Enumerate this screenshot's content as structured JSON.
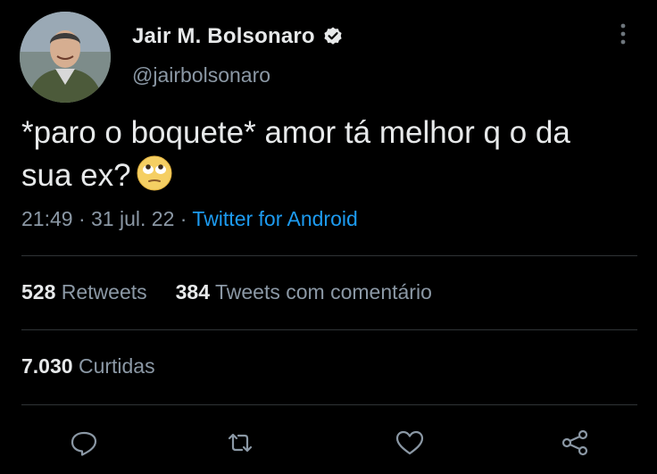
{
  "author": {
    "name": "Jair M. Bolsonaro",
    "handle": "@jairbolsonaro",
    "verified": true
  },
  "tweet": {
    "text": "*paro o boquete* amor tá melhor q o da sua ex?",
    "emoji": "face-with-rolling-eyes",
    "time": "21:49",
    "separator1": "·",
    "date": "31 jul. 22",
    "separator2": "·",
    "source": "Twitter for Android"
  },
  "stats": {
    "retweets_count": "528",
    "retweets_label": "Retweets",
    "quotes_count": "384",
    "quotes_label": "Tweets com comentário",
    "likes_count": "7.030",
    "likes_label": "Curtidas"
  },
  "colors": {
    "background": "#000000",
    "text": "#e7e9ea",
    "secondary": "#8b98a5",
    "link": "#1d9bf0",
    "divider": "#2f3336"
  },
  "icons": [
    "more-icon",
    "verified-icon",
    "reply-icon",
    "retweet-icon",
    "like-icon",
    "share-icon"
  ]
}
